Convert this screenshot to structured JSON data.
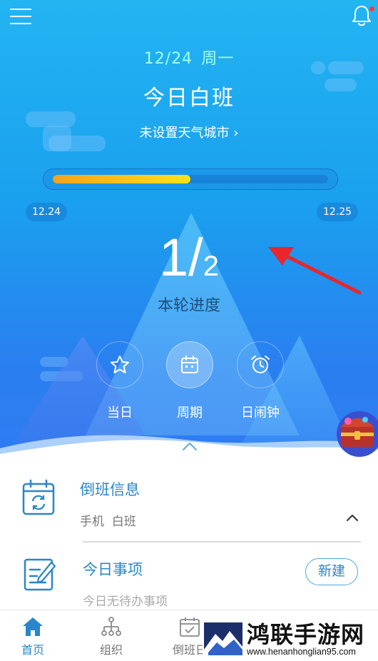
{
  "header": {
    "date": "12/24",
    "weekday": "周一",
    "title": "今日白班",
    "weather_link": "未设置天气城市 ›",
    "menu_icon": "hamburger-menu-icon",
    "bell_icon": "bell-icon",
    "notification_dot_color": "#ff3b30"
  },
  "progress": {
    "fill_fraction": 0.5,
    "start_day": "12.24",
    "end_day": "12.25",
    "current": "1",
    "total": "2",
    "label": "本轮进度"
  },
  "actions": [
    {
      "label": "当日",
      "icon": "star-icon"
    },
    {
      "label": "周期",
      "icon": "calendar-icon"
    },
    {
      "label": "日闹钟",
      "icon": "alarm-clock-icon"
    }
  ],
  "cards": {
    "shift_info": {
      "title": "倒班信息",
      "subtitle": "手机  白班",
      "icon": "calendar-sync-icon"
    },
    "today_items": {
      "title": "今日事项",
      "subtitle": "今日无待办事项",
      "new_button": "新建",
      "icon": "note-edit-icon"
    }
  },
  "bottom_nav": [
    {
      "label": "首页",
      "icon": "home-icon",
      "active": true
    },
    {
      "label": "组织",
      "icon": "org-chart-icon",
      "active": false
    },
    {
      "label": "倒班日",
      "icon": "calendar-check-icon",
      "active": false
    }
  ],
  "watermark": {
    "title": "鸿联手游网",
    "url": "www.henanhonglian95.com"
  },
  "colors": {
    "accent": "#2a86c8",
    "date_text": "#a6ffea",
    "progress_start": "#f6a21a",
    "progress_end": "#ffe21a",
    "annotation_arrow": "#e8262c"
  }
}
